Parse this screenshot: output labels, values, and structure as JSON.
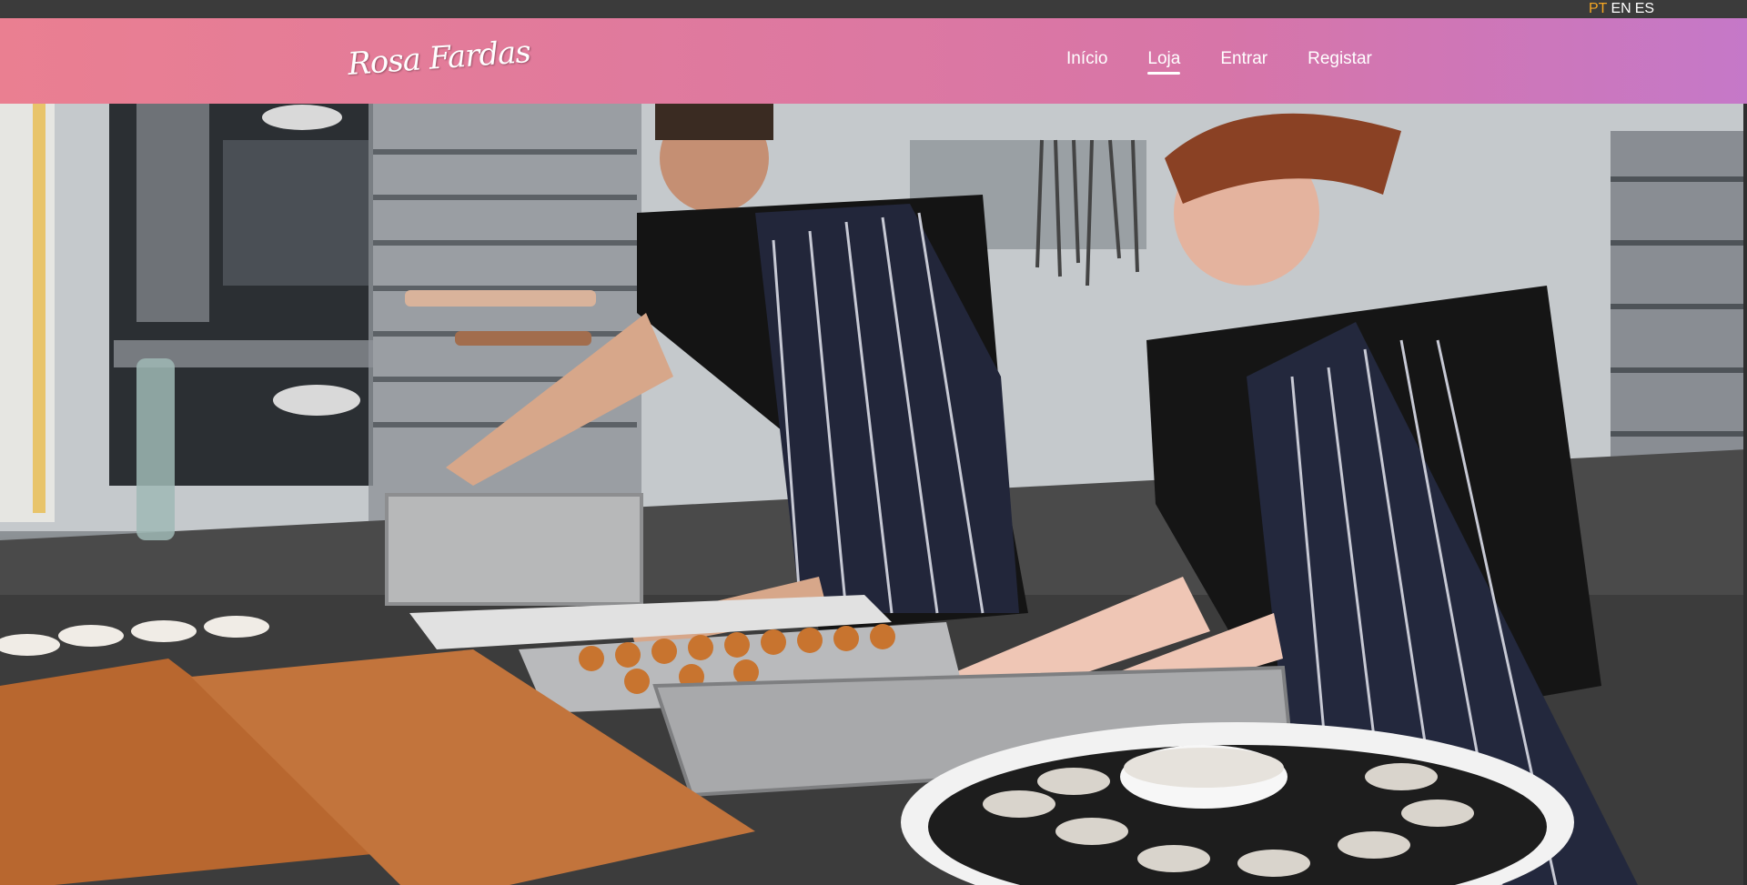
{
  "languages": {
    "items": [
      "PT",
      "EN",
      "ES"
    ],
    "active": "PT",
    "active_color": "#f5a623"
  },
  "header": {
    "logo_text": "Rosa Fardas",
    "gradient_colors": [
      "#ea7f91",
      "#d775a8",
      "#c578c8"
    ]
  },
  "nav": {
    "items": [
      {
        "label": "Início"
      },
      {
        "label": "Loja"
      },
      {
        "label": "Entrar"
      },
      {
        "label": "Registar"
      }
    ],
    "active": "Loja"
  },
  "hero": {
    "image_subject": "hero-kitchen-photo"
  }
}
